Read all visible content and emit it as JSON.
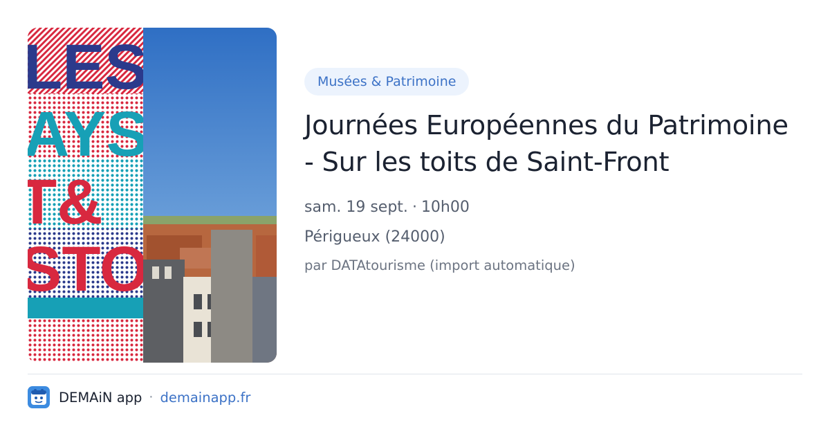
{
  "event": {
    "category": "Musées & Patrimoine",
    "title": "Journées Européennes du Patrimoine - Sur les toits de Saint-Front",
    "date": "sam. 19 sept.",
    "time": "10h00",
    "date_separator": "·",
    "location": "Périgueux (24000)",
    "author": "par DATAtourisme (import automatique)"
  },
  "poster": {
    "letters_row1": "LES",
    "letters_row2": "AYS",
    "letters_row3": "T&",
    "letters_row4": "STO"
  },
  "footer": {
    "app_name": "DEMAiN app",
    "separator": "·",
    "site": "demainapp.fr"
  },
  "colors": {
    "brand_blue": "#3c72c6",
    "tag_bg": "#ecf3fd",
    "poster_red": "#d8283f",
    "poster_navy": "#2b3a8c",
    "poster_teal": "#17a0b6"
  },
  "icons": {
    "app": "demain-app-icon"
  }
}
